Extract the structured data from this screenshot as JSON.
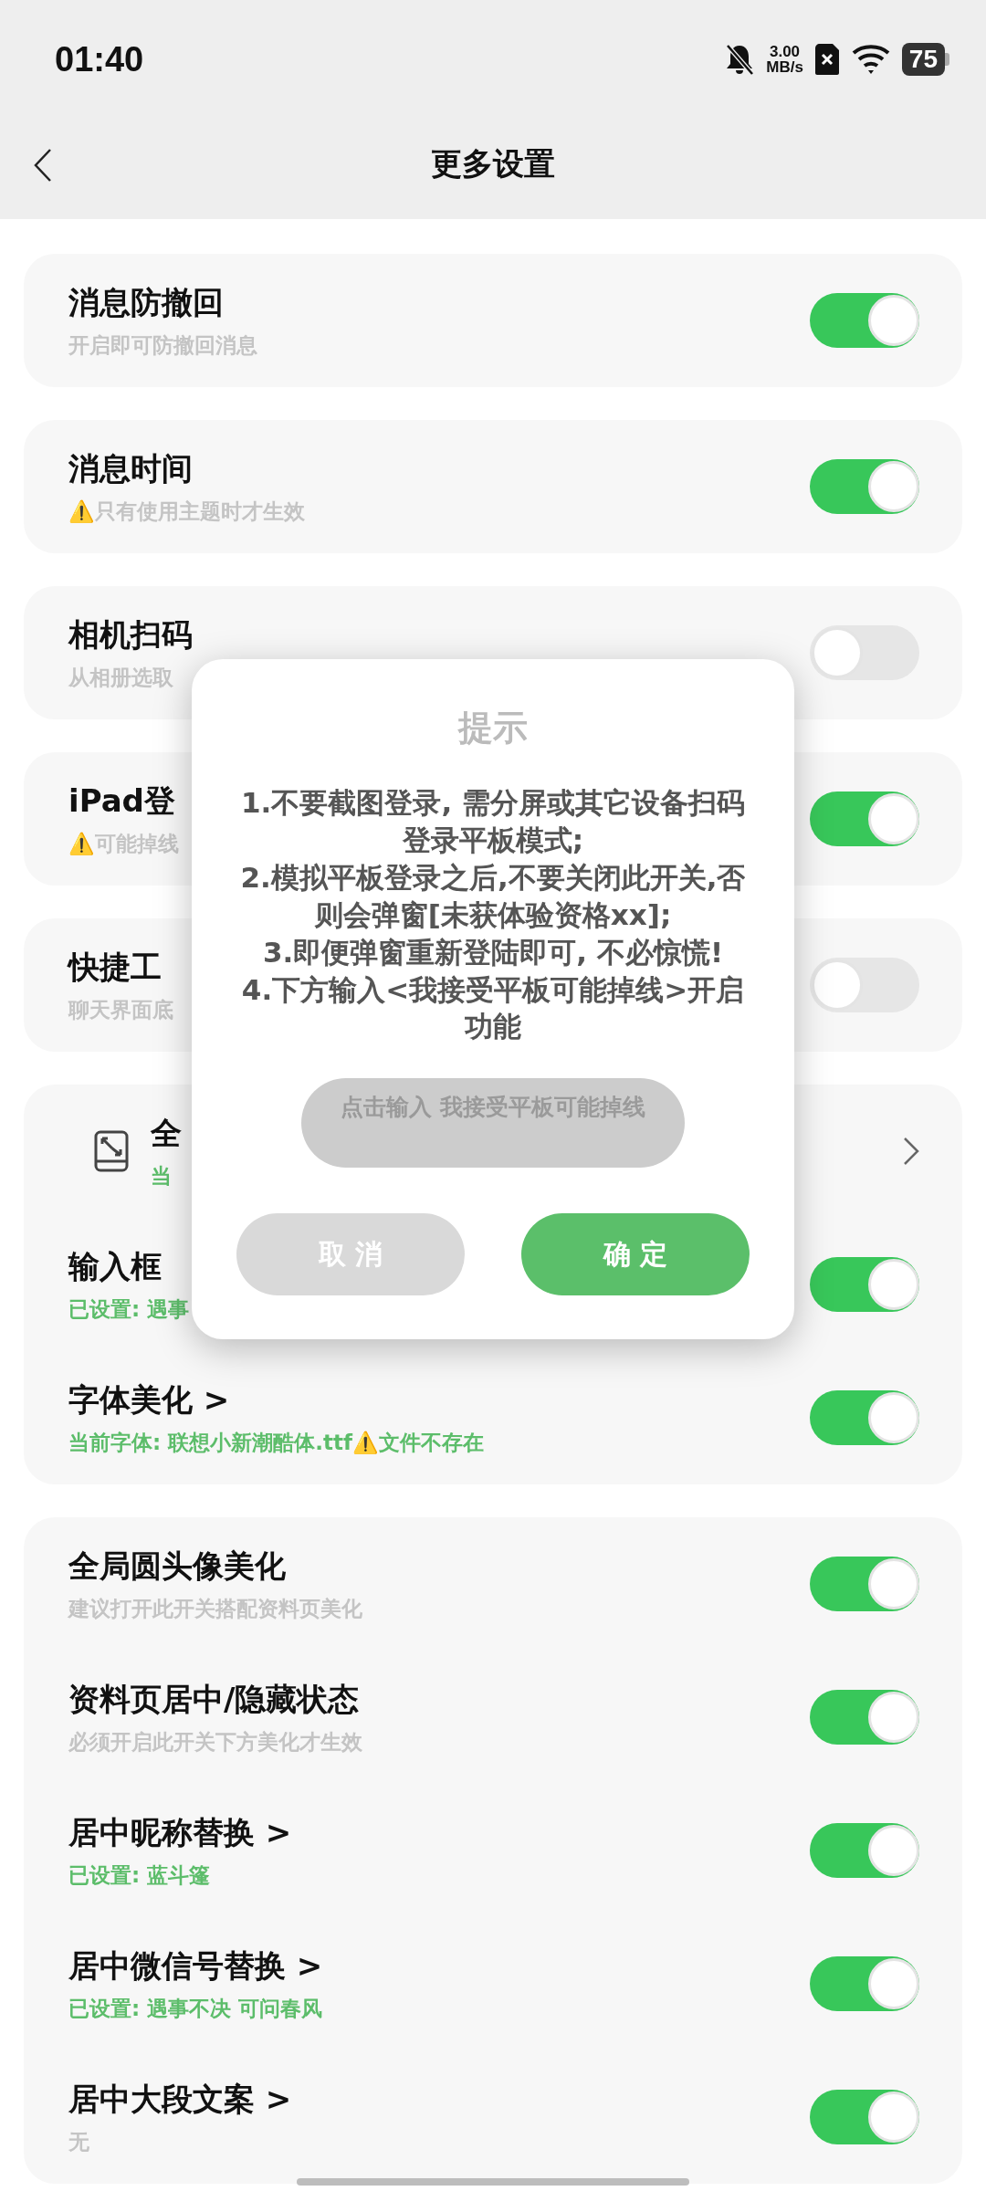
{
  "status_bar": {
    "time": "01:40",
    "speed_value": "3.00",
    "speed_unit": "MB/s",
    "battery": "75"
  },
  "header": {
    "title": "更多设置"
  },
  "cards": [
    {
      "rows": [
        {
          "kind": "toggle",
          "title": "消息防撤回",
          "subtitle": "开启即可防撤回消息",
          "accent": false,
          "on": true
        }
      ]
    },
    {
      "rows": [
        {
          "kind": "toggle",
          "title": "消息时间",
          "subtitle": "⚠️只有使用主题时才生效",
          "accent": false,
          "on": true
        }
      ]
    },
    {
      "rows": [
        {
          "kind": "toggle",
          "title": "相机扫码",
          "subtitle": "从相册选取",
          "accent": false,
          "on": false
        }
      ]
    },
    {
      "rows": [
        {
          "kind": "toggle",
          "title": "iPad登",
          "subtitle": "⚠️可能掉线",
          "accent": false,
          "on": true
        }
      ]
    },
    {
      "rows": [
        {
          "kind": "toggle",
          "title": "快捷工",
          "subtitle": "聊天界面底",
          "accent": false,
          "on": false
        }
      ]
    },
    {
      "rows": [
        {
          "kind": "link",
          "title": "全",
          "subtitle": "当",
          "accent": true
        },
        {
          "kind": "toggle",
          "title": "输入框",
          "subtitle": "已设置: 遇事",
          "accent": true,
          "on": true
        },
        {
          "kind": "toggle",
          "title": "字体美化 >",
          "subtitle": "当前字体: 联想小新潮酷体.ttf⚠️文件不存在",
          "accent": true,
          "on": true
        }
      ]
    },
    {
      "rows": [
        {
          "kind": "toggle",
          "title": "全局圆头像美化",
          "subtitle": "建议打开此开关搭配资料页美化",
          "accent": false,
          "on": true
        },
        {
          "kind": "toggle",
          "title": "资料页居中/隐藏状态",
          "subtitle": "必须开启此开关下方美化才生效",
          "accent": false,
          "on": true
        },
        {
          "kind": "toggle",
          "title": "居中昵称替换 >",
          "subtitle": "已设置: 蓝斗篷",
          "accent": true,
          "on": true
        },
        {
          "kind": "toggle",
          "title": "居中微信号替换 >",
          "subtitle": "已设置: 遇事不决 可问春风",
          "accent": true,
          "on": true
        },
        {
          "kind": "toggle",
          "title": "居中大段文案 >",
          "subtitle": "无",
          "accent": false,
          "on": true
        }
      ]
    }
  ],
  "dialog": {
    "title": "提示",
    "message": "1.不要截图登录, 需分屏或其它设备扫码登录平板模式;\n2.模拟平板登录之后,不要关闭此开关,否则会弹窗[未获体验资格xx];\n3.即便弹窗重新登陆即可, 不必惊慌!\n4.下方输入<我接受平板可能掉线>开启功能",
    "placeholder": "点击输入 我接受平板可能掉线",
    "cancel": "取 消",
    "confirm": "确 定"
  }
}
